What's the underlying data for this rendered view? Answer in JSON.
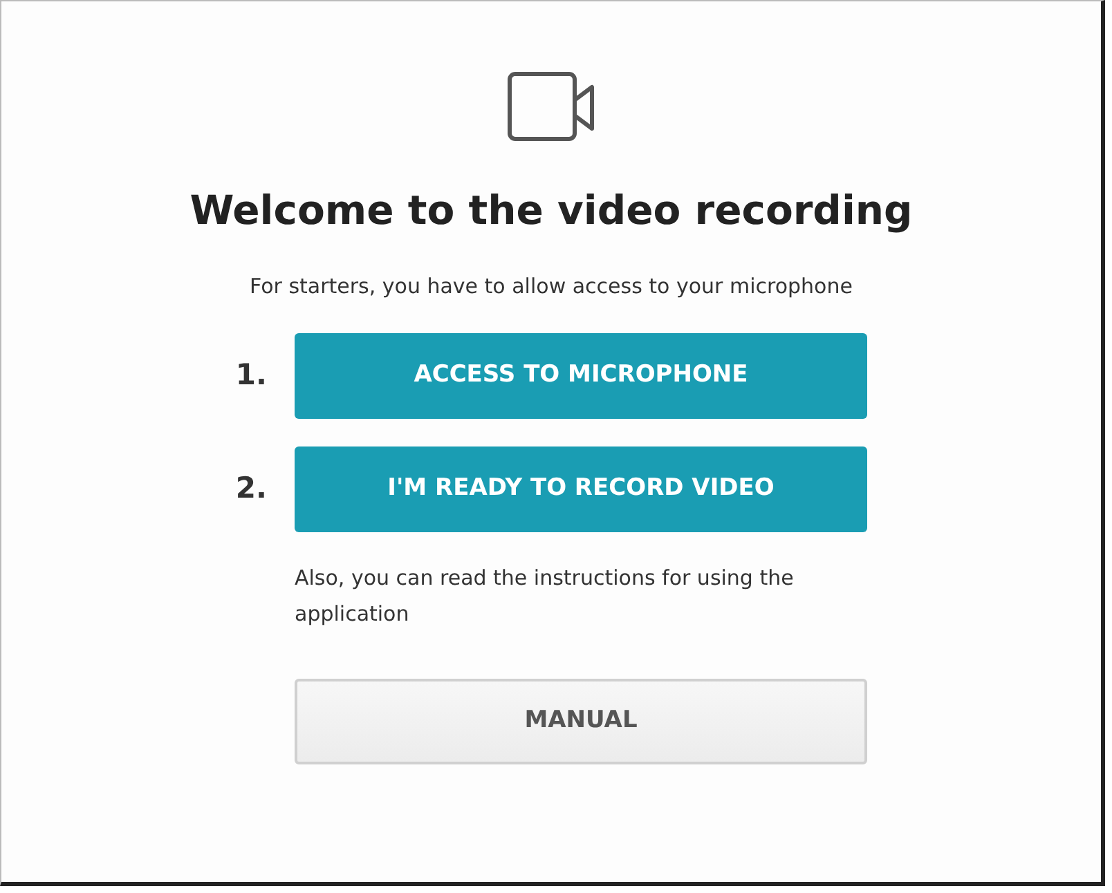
{
  "title": "Welcome to the video recording",
  "intro": "For starters, you have to allow access to your microphone",
  "steps": [
    {
      "number": "1.",
      "label": "ACCESS TO MICROPHONE"
    },
    {
      "number": "2.",
      "label": "I'M READY TO RECORD VIDEO"
    }
  ],
  "note": "Also, you can read the instructions for using the application",
  "manual_button": "MANUAL"
}
